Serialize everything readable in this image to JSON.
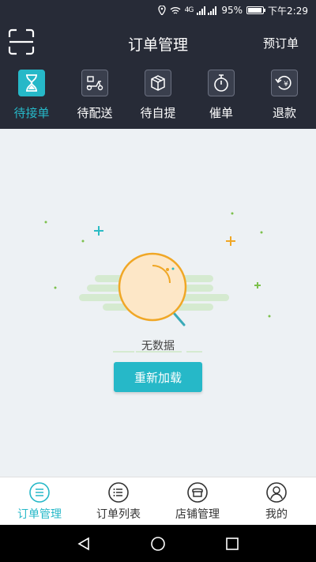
{
  "status_bar": {
    "signal_text": "4G",
    "battery": "95%",
    "time": "下午2:29"
  },
  "header": {
    "title": "订单管理",
    "right_action": "预订单"
  },
  "tabs": [
    {
      "label": "待接单",
      "icon": "hourglass-icon",
      "active": true
    },
    {
      "label": "待配送",
      "icon": "scooter-icon",
      "active": false
    },
    {
      "label": "待自提",
      "icon": "package-icon",
      "active": false
    },
    {
      "label": "催单",
      "icon": "stopwatch-icon",
      "active": false
    },
    {
      "label": "退款",
      "icon": "refund-icon",
      "active": false
    }
  ],
  "empty_state": {
    "text": "无数据",
    "reload_label": "重新加载"
  },
  "bottom_nav": [
    {
      "label": "订单管理",
      "icon": "order-manage-icon",
      "active": true
    },
    {
      "label": "订单列表",
      "icon": "order-list-icon",
      "active": false
    },
    {
      "label": "店铺管理",
      "icon": "shop-icon",
      "active": false
    },
    {
      "label": "我的",
      "icon": "user-icon",
      "active": false
    }
  ],
  "colors": {
    "accent": "#26b8c8",
    "header_bg": "#272b37",
    "content_bg": "#edf1f4"
  }
}
